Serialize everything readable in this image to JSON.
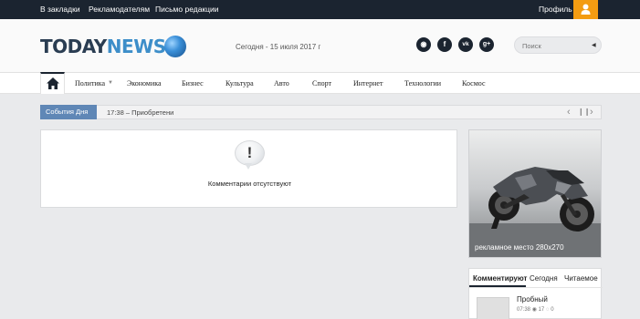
{
  "topbar": {
    "links": [
      "В закладки",
      "Рекламодателям",
      "Письмо редакции"
    ],
    "profile_label": "Профиль",
    "profile_icon": "user-icon"
  },
  "header": {
    "logo_today": "TODAY",
    "logo_news": "NEWS",
    "date_text": "Сегодня - 15 июля 2017 г",
    "social_icons": [
      "rss-icon",
      "facebook-icon",
      "vk-icon",
      "google-plus-icon"
    ],
    "social_glyphs": [
      "◉",
      "f",
      "vk",
      "g+"
    ],
    "search_placeholder": "Поиск"
  },
  "nav": {
    "home_icon": "home-icon",
    "items": [
      "Политика",
      "Экономика",
      "Бизнес",
      "Культура",
      "Авто",
      "Спорт",
      "Интернет",
      "Технологии",
      "Космос"
    ]
  },
  "ticker": {
    "label": "События Дня",
    "text": "17:38 – Приобретени",
    "prev": "‹",
    "pause": "❙❙",
    "next": "›"
  },
  "content": {
    "icon": "comment-warning-icon",
    "mark": "!",
    "message": "Комментарии отсутствуют"
  },
  "ad": {
    "caption": "рекламное место 280x270"
  },
  "sidebar_tabs": {
    "tabs": [
      "Комментируют",
      "Сегодня",
      "Читаемое"
    ],
    "post": {
      "title": "Пробный",
      "time": "07:38",
      "views": "17",
      "comments": "0"
    }
  },
  "colors": {
    "topbar": "#1b2430",
    "accent_orange": "#f39c12",
    "logo_dark": "#2a3d52",
    "logo_blue": "#3d8ec9",
    "ticker_label": "#5f87b6",
    "background": "#e9eaec"
  }
}
